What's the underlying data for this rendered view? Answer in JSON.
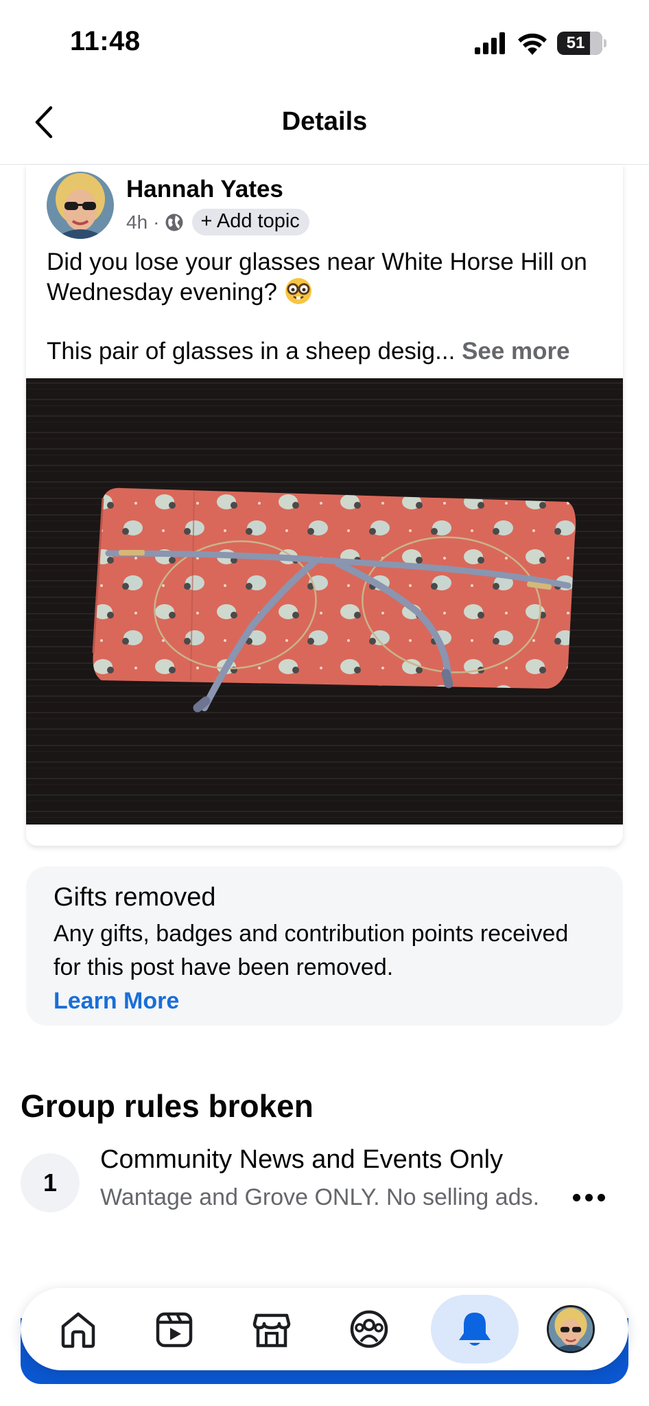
{
  "status_bar": {
    "time": "11:48",
    "battery": "51"
  },
  "header": {
    "title": "Details"
  },
  "post": {
    "author": "Hannah Yates",
    "time_ago": "4h",
    "meta_separator": "·",
    "add_topic_label": "+ Add topic",
    "text_line1": "Did you lose your glasses near White Horse Hill on Wednesday evening?",
    "text_line2": "This pair of glasses in a sheep desig...",
    "see_more_label": "See more"
  },
  "gifts_notice": {
    "title": "Gifts removed",
    "body": "Any gifts, badges and contribution points received for this post have been removed.",
    "link_label": "Learn More"
  },
  "rules": {
    "heading": "Group rules broken",
    "items": [
      {
        "number": "1",
        "title": "Community News and Events Only",
        "description": "Wantage and Grove ONLY. No selling ads."
      }
    ]
  },
  "tab_bar": {
    "tabs": [
      {
        "icon": "home-icon",
        "active": false
      },
      {
        "icon": "video-icon",
        "active": false
      },
      {
        "icon": "marketplace-icon",
        "active": false
      },
      {
        "icon": "groups-icon",
        "active": false
      },
      {
        "icon": "notifications-icon",
        "active": true
      },
      {
        "icon": "profile-avatar",
        "active": false
      }
    ]
  },
  "colors": {
    "accent_blue": "#1a6ed8",
    "tab_active_bg": "#dbe7fb",
    "secondary_text": "#65676b",
    "card_bg": "#f5f6f8"
  }
}
